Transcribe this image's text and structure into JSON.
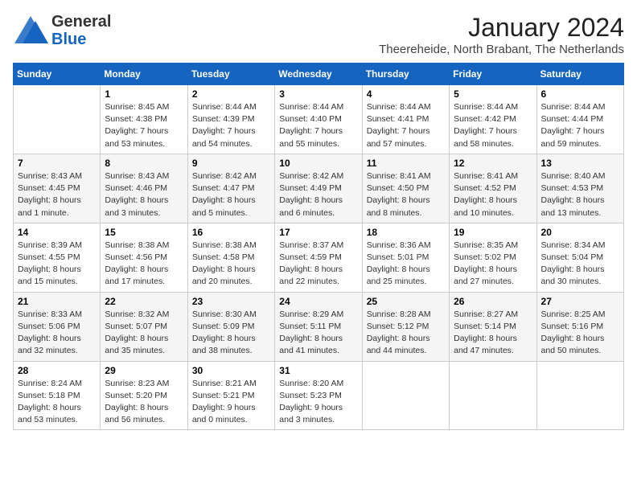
{
  "header": {
    "logo_general": "General",
    "logo_blue": "Blue",
    "month_title": "January 2024",
    "location": "Theereheide, North Brabant, The Netherlands"
  },
  "weekdays": [
    "Sunday",
    "Monday",
    "Tuesday",
    "Wednesday",
    "Thursday",
    "Friday",
    "Saturday"
  ],
  "weeks": [
    [
      {
        "day": "",
        "sunrise": "",
        "sunset": "",
        "daylight": ""
      },
      {
        "day": "1",
        "sunrise": "Sunrise: 8:45 AM",
        "sunset": "Sunset: 4:38 PM",
        "daylight": "Daylight: 7 hours and 53 minutes."
      },
      {
        "day": "2",
        "sunrise": "Sunrise: 8:44 AM",
        "sunset": "Sunset: 4:39 PM",
        "daylight": "Daylight: 7 hours and 54 minutes."
      },
      {
        "day": "3",
        "sunrise": "Sunrise: 8:44 AM",
        "sunset": "Sunset: 4:40 PM",
        "daylight": "Daylight: 7 hours and 55 minutes."
      },
      {
        "day": "4",
        "sunrise": "Sunrise: 8:44 AM",
        "sunset": "Sunset: 4:41 PM",
        "daylight": "Daylight: 7 hours and 57 minutes."
      },
      {
        "day": "5",
        "sunrise": "Sunrise: 8:44 AM",
        "sunset": "Sunset: 4:42 PM",
        "daylight": "Daylight: 7 hours and 58 minutes."
      },
      {
        "day": "6",
        "sunrise": "Sunrise: 8:44 AM",
        "sunset": "Sunset: 4:44 PM",
        "daylight": "Daylight: 7 hours and 59 minutes."
      }
    ],
    [
      {
        "day": "7",
        "sunrise": "Sunrise: 8:43 AM",
        "sunset": "Sunset: 4:45 PM",
        "daylight": "Daylight: 8 hours and 1 minute."
      },
      {
        "day": "8",
        "sunrise": "Sunrise: 8:43 AM",
        "sunset": "Sunset: 4:46 PM",
        "daylight": "Daylight: 8 hours and 3 minutes."
      },
      {
        "day": "9",
        "sunrise": "Sunrise: 8:42 AM",
        "sunset": "Sunset: 4:47 PM",
        "daylight": "Daylight: 8 hours and 5 minutes."
      },
      {
        "day": "10",
        "sunrise": "Sunrise: 8:42 AM",
        "sunset": "Sunset: 4:49 PM",
        "daylight": "Daylight: 8 hours and 6 minutes."
      },
      {
        "day": "11",
        "sunrise": "Sunrise: 8:41 AM",
        "sunset": "Sunset: 4:50 PM",
        "daylight": "Daylight: 8 hours and 8 minutes."
      },
      {
        "day": "12",
        "sunrise": "Sunrise: 8:41 AM",
        "sunset": "Sunset: 4:52 PM",
        "daylight": "Daylight: 8 hours and 10 minutes."
      },
      {
        "day": "13",
        "sunrise": "Sunrise: 8:40 AM",
        "sunset": "Sunset: 4:53 PM",
        "daylight": "Daylight: 8 hours and 13 minutes."
      }
    ],
    [
      {
        "day": "14",
        "sunrise": "Sunrise: 8:39 AM",
        "sunset": "Sunset: 4:55 PM",
        "daylight": "Daylight: 8 hours and 15 minutes."
      },
      {
        "day": "15",
        "sunrise": "Sunrise: 8:38 AM",
        "sunset": "Sunset: 4:56 PM",
        "daylight": "Daylight: 8 hours and 17 minutes."
      },
      {
        "day": "16",
        "sunrise": "Sunrise: 8:38 AM",
        "sunset": "Sunset: 4:58 PM",
        "daylight": "Daylight: 8 hours and 20 minutes."
      },
      {
        "day": "17",
        "sunrise": "Sunrise: 8:37 AM",
        "sunset": "Sunset: 4:59 PM",
        "daylight": "Daylight: 8 hours and 22 minutes."
      },
      {
        "day": "18",
        "sunrise": "Sunrise: 8:36 AM",
        "sunset": "Sunset: 5:01 PM",
        "daylight": "Daylight: 8 hours and 25 minutes."
      },
      {
        "day": "19",
        "sunrise": "Sunrise: 8:35 AM",
        "sunset": "Sunset: 5:02 PM",
        "daylight": "Daylight: 8 hours and 27 minutes."
      },
      {
        "day": "20",
        "sunrise": "Sunrise: 8:34 AM",
        "sunset": "Sunset: 5:04 PM",
        "daylight": "Daylight: 8 hours and 30 minutes."
      }
    ],
    [
      {
        "day": "21",
        "sunrise": "Sunrise: 8:33 AM",
        "sunset": "Sunset: 5:06 PM",
        "daylight": "Daylight: 8 hours and 32 minutes."
      },
      {
        "day": "22",
        "sunrise": "Sunrise: 8:32 AM",
        "sunset": "Sunset: 5:07 PM",
        "daylight": "Daylight: 8 hours and 35 minutes."
      },
      {
        "day": "23",
        "sunrise": "Sunrise: 8:30 AM",
        "sunset": "Sunset: 5:09 PM",
        "daylight": "Daylight: 8 hours and 38 minutes."
      },
      {
        "day": "24",
        "sunrise": "Sunrise: 8:29 AM",
        "sunset": "Sunset: 5:11 PM",
        "daylight": "Daylight: 8 hours and 41 minutes."
      },
      {
        "day": "25",
        "sunrise": "Sunrise: 8:28 AM",
        "sunset": "Sunset: 5:12 PM",
        "daylight": "Daylight: 8 hours and 44 minutes."
      },
      {
        "day": "26",
        "sunrise": "Sunrise: 8:27 AM",
        "sunset": "Sunset: 5:14 PM",
        "daylight": "Daylight: 8 hours and 47 minutes."
      },
      {
        "day": "27",
        "sunrise": "Sunrise: 8:25 AM",
        "sunset": "Sunset: 5:16 PM",
        "daylight": "Daylight: 8 hours and 50 minutes."
      }
    ],
    [
      {
        "day": "28",
        "sunrise": "Sunrise: 8:24 AM",
        "sunset": "Sunset: 5:18 PM",
        "daylight": "Daylight: 8 hours and 53 minutes."
      },
      {
        "day": "29",
        "sunrise": "Sunrise: 8:23 AM",
        "sunset": "Sunset: 5:20 PM",
        "daylight": "Daylight: 8 hours and 56 minutes."
      },
      {
        "day": "30",
        "sunrise": "Sunrise: 8:21 AM",
        "sunset": "Sunset: 5:21 PM",
        "daylight": "Daylight: 9 hours and 0 minutes."
      },
      {
        "day": "31",
        "sunrise": "Sunrise: 8:20 AM",
        "sunset": "Sunset: 5:23 PM",
        "daylight": "Daylight: 9 hours and 3 minutes."
      },
      {
        "day": "",
        "sunrise": "",
        "sunset": "",
        "daylight": ""
      },
      {
        "day": "",
        "sunrise": "",
        "sunset": "",
        "daylight": ""
      },
      {
        "day": "",
        "sunrise": "",
        "sunset": "",
        "daylight": ""
      }
    ]
  ]
}
